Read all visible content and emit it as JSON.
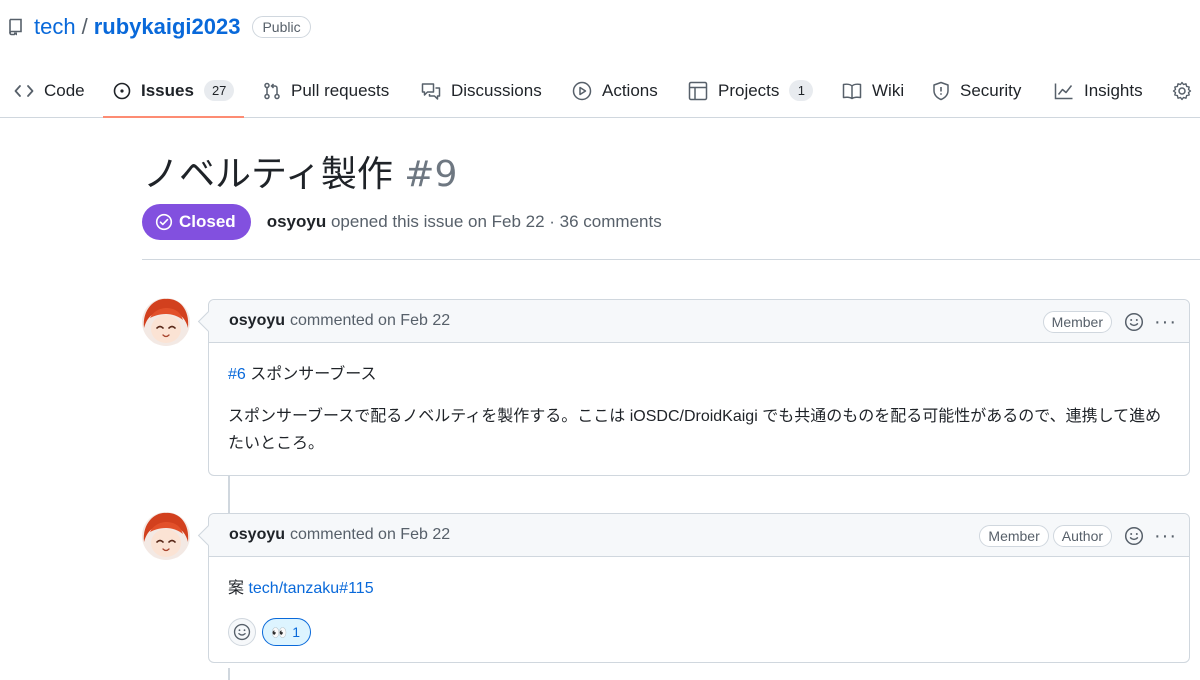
{
  "repo": {
    "owner": "tech",
    "separator": "/",
    "name": "rubykaigi2023",
    "visibility": "Public"
  },
  "tabs": [
    {
      "label": "Code",
      "icon": "code-icon"
    },
    {
      "label": "Issues",
      "icon": "issue-opened-icon",
      "counter": "27",
      "selected": true
    },
    {
      "label": "Pull requests",
      "icon": "git-pull-request-icon"
    },
    {
      "label": "Discussions",
      "icon": "comment-discussion-icon"
    },
    {
      "label": "Actions",
      "icon": "play-icon"
    },
    {
      "label": "Projects",
      "icon": "table-icon",
      "counter": "1"
    },
    {
      "label": "Wiki",
      "icon": "book-icon"
    },
    {
      "label": "Security",
      "icon": "shield-icon"
    },
    {
      "label": "Insights",
      "icon": "graph-icon"
    },
    {
      "label": "",
      "icon": "gear-icon"
    }
  ],
  "issue": {
    "title": "ノベルティ製作",
    "number": "#9",
    "state": "Closed",
    "author": "osyoyu",
    "meta": "opened this issue on Feb 22 · 36 comments"
  },
  "comments": [
    {
      "author": "osyoyu",
      "meta": "commented on Feb 22",
      "labels": [
        "Member"
      ],
      "body_link": "#6",
      "body_link_suffix": " スポンサーブース",
      "body_paragraph": "スポンサーブースで配るノベルティを製作する。ここは iOSDC/DroidKaigi でも共通のものを配る可能性があるので、連携して進めたいところ。"
    },
    {
      "author": "osyoyu",
      "meta": "commented on Feb 22",
      "labels": [
        "Member",
        "Author"
      ],
      "body_prefix": "案 ",
      "body_link": "tech/tanzaku#115",
      "reaction": {
        "emoji": "👀",
        "count": "1"
      }
    }
  ],
  "colors": {
    "accent": "#0969da",
    "closed": "#8250df",
    "tab_underline": "#fd8c73",
    "border": "#d0d7de"
  }
}
